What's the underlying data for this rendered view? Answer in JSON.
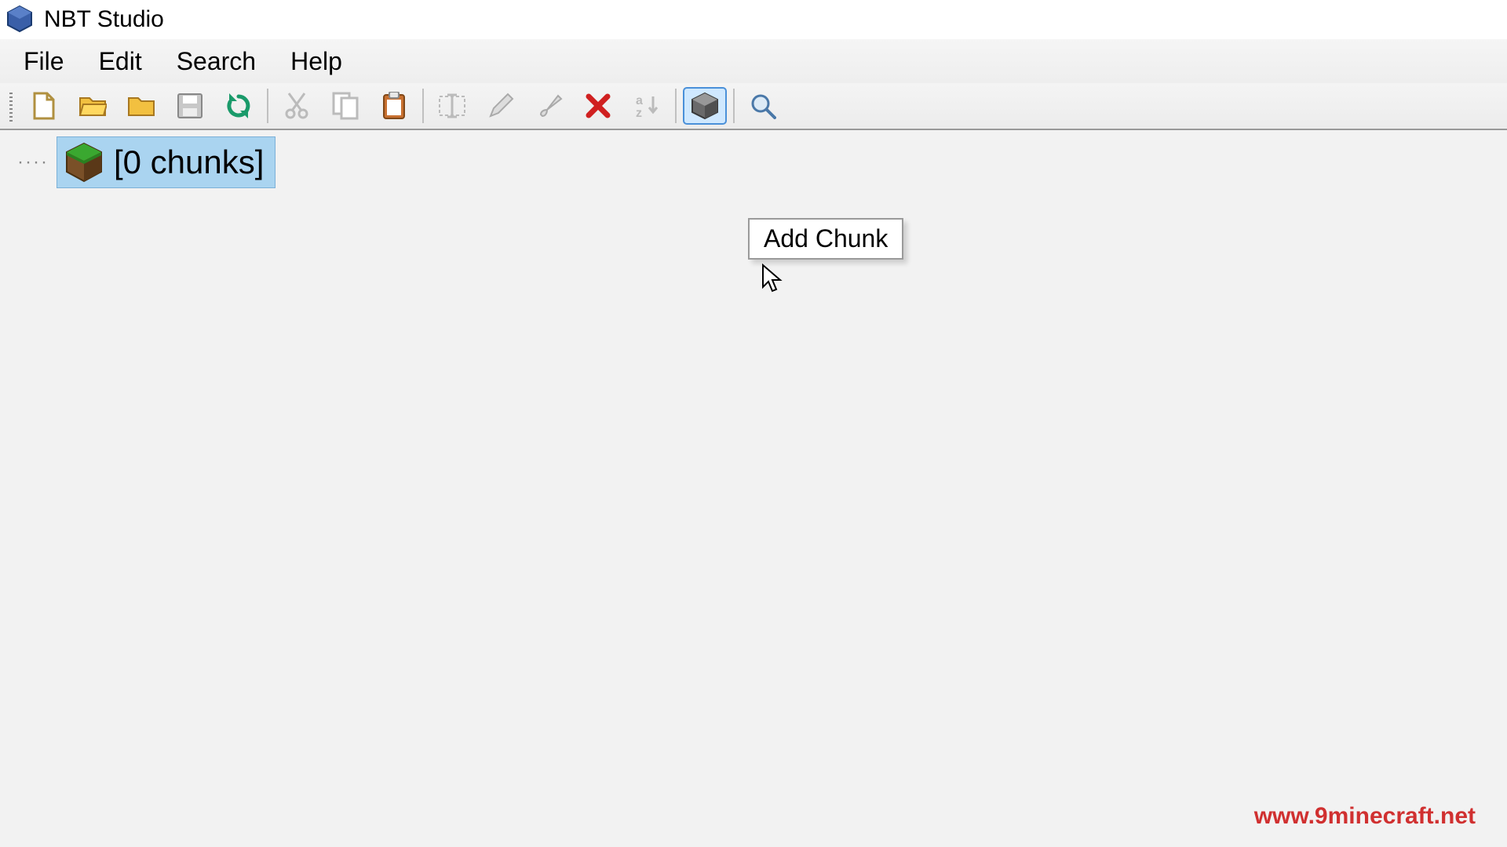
{
  "title": "NBT Studio",
  "menubar": [
    "File",
    "Edit",
    "Search",
    "Help"
  ],
  "toolbar": {
    "active_button": "add-chunk"
  },
  "tree": {
    "root_label": "[0 chunks]"
  },
  "tooltip": "Add Chunk",
  "watermark": "www.9minecraft.net"
}
